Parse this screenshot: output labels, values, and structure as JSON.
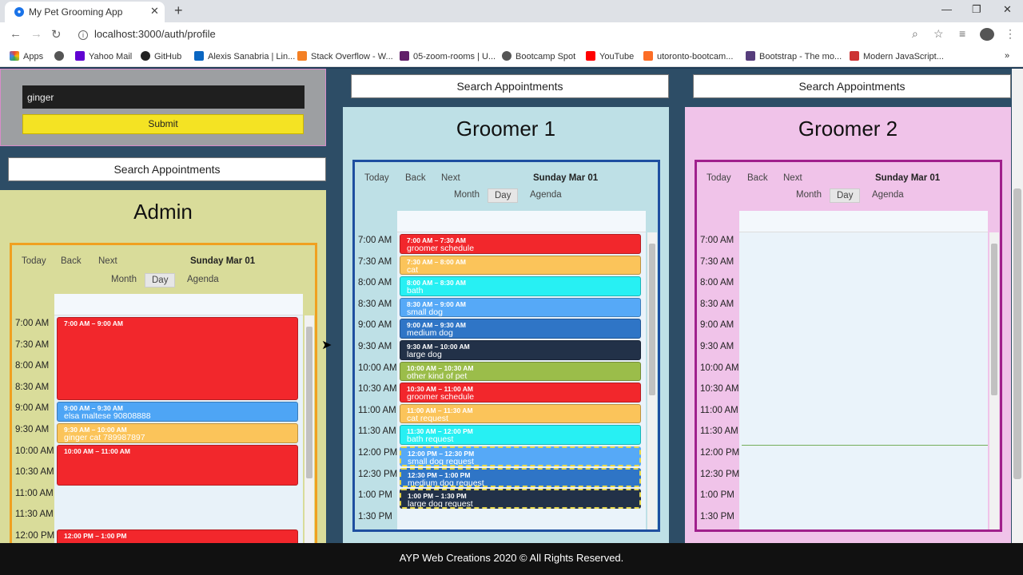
{
  "browser": {
    "tab_title": "My Pet Grooming App",
    "url": "localhost:3000/auth/profile",
    "bookmarks": [
      "Apps",
      "Yahoo Mail",
      "GitHub",
      "Alexis Sanabria | Lin...",
      "Stack Overflow - W...",
      "05-zoom-rooms | U...",
      "Bootcamp Spot",
      "YouTube",
      "utoronto-bootcam...",
      "Bootstrap - The mo...",
      "Modern JavaScript..."
    ]
  },
  "search": {
    "input_value": "ginger",
    "submit_label": "Submit",
    "search_label": "Search Appointments"
  },
  "toolbar": {
    "today": "Today",
    "back": "Back",
    "next": "Next",
    "date": "Sunday Mar 01",
    "month": "Month",
    "day": "Day",
    "agenda": "Agenda"
  },
  "admin": {
    "title": "Admin",
    "times": [
      "7:00 AM",
      "7:30 AM",
      "8:00 AM",
      "8:30 AM",
      "9:00 AM",
      "9:30 AM",
      "10:00 AM",
      "10:30 AM",
      "11:00 AM",
      "11:30 AM",
      "12:00 PM"
    ],
    "events": [
      {
        "time": "7:00 AM – 9:00 AM",
        "name": "",
        "color": "#f2272c"
      },
      {
        "time": "9:00 AM – 9:30 AM",
        "name": "elsa maltese 90808888",
        "color": "#4ea5f5"
      },
      {
        "time": "9:30 AM – 10:00 AM",
        "name": "ginger cat 789987897",
        "color": "#fbc45a"
      },
      {
        "time": "10:00 AM – 11:00 AM",
        "name": "",
        "color": "#f2272c"
      },
      {
        "time": "12:00 PM – 1:00 PM",
        "name": "",
        "color": "#f2272c"
      }
    ]
  },
  "groomer1": {
    "title": "Groomer 1",
    "times": [
      "7:00 AM",
      "7:30 AM",
      "8:00 AM",
      "8:30 AM",
      "9:00 AM",
      "9:30 AM",
      "10:00 AM",
      "10:30 AM",
      "11:00 AM",
      "11:30 AM",
      "12:00 PM",
      "12:30 PM",
      "1:00 PM",
      "1:30 PM"
    ],
    "events": [
      {
        "time": "7:00 AM – 7:30 AM",
        "name": "groomer schedule",
        "color": "#f2272c"
      },
      {
        "time": "7:30 AM – 8:00 AM",
        "name": "cat",
        "color": "#fbc45a"
      },
      {
        "time": "8:00 AM – 8:30 AM",
        "name": "bath",
        "color": "#27f0f3"
      },
      {
        "time": "8:30 AM – 9:00 AM",
        "name": "small dog",
        "color": "#56a9f7"
      },
      {
        "time": "9:00 AM – 9:30 AM",
        "name": "medium dog",
        "color": "#2f75c6"
      },
      {
        "time": "9:30 AM – 10:00 AM",
        "name": "large dog",
        "color": "#223148"
      },
      {
        "time": "10:00 AM – 10:30 AM",
        "name": "other kind of pet",
        "color": "#9bbd4a"
      },
      {
        "time": "10:30 AM – 11:00 AM",
        "name": "groomer schedule",
        "color": "#f2272c"
      },
      {
        "time": "11:00 AM – 11:30 AM",
        "name": "cat request",
        "color": "#fbc45a"
      },
      {
        "time": "11:30 AM – 12:00 PM",
        "name": "bath request",
        "color": "#27f0f3"
      },
      {
        "time": "12:00 PM – 12:30 PM",
        "name": "small dog request",
        "color": "#56a9f7"
      },
      {
        "time": "12:30 PM – 1:00 PM",
        "name": "medium dog request",
        "color": "#2f75c6"
      },
      {
        "time": "1:00 PM – 1:30 PM",
        "name": "large dog request",
        "color": "#223148"
      }
    ]
  },
  "groomer2": {
    "title": "Groomer 2",
    "times": [
      "7:00 AM",
      "7:30 AM",
      "8:00 AM",
      "8:30 AM",
      "9:00 AM",
      "9:30 AM",
      "10:00 AM",
      "10:30 AM",
      "11:00 AM",
      "11:30 AM",
      "12:00 PM",
      "12:30 PM",
      "1:00 PM",
      "1:30 PM"
    ]
  },
  "footer": "AYP Web Creations 2020 © All Rights Reserved."
}
